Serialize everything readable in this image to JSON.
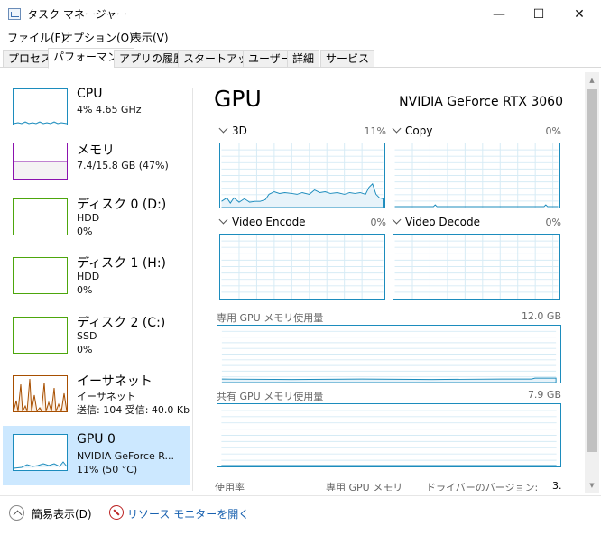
{
  "window": {
    "title": "タスク マネージャー",
    "minimize_glyph": "—",
    "maximize_glyph": "☐",
    "close_glyph": "✕"
  },
  "menu": [
    "ファイル(F)",
    "オプション(O)",
    "表示(V)"
  ],
  "tabs": [
    {
      "label": "プロセス",
      "active": false
    },
    {
      "label": "パフォーマンス",
      "active": true
    },
    {
      "label": "アプリの履歴",
      "active": false
    },
    {
      "label": "スタートアップ",
      "active": false
    },
    {
      "label": "ユーザー",
      "active": false
    },
    {
      "label": "詳細",
      "active": false
    },
    {
      "label": "サービス",
      "active": false
    }
  ],
  "sidebar": {
    "items": [
      {
        "name": "CPU",
        "line1": "4%  4.65 GHz",
        "line2": "",
        "line3": "",
        "color": "#1c8cbd"
      },
      {
        "name": "メモリ",
        "line1": "7.4/15.8 GB (47%)",
        "line2": "",
        "line3": "",
        "color": "#8b12ae",
        "fill": 0.47
      },
      {
        "name": "ディスク 0 (D:)",
        "line1": "HDD",
        "line2": "0%",
        "line3": "",
        "color": "#4da60c"
      },
      {
        "name": "ディスク 1 (H:)",
        "line1": "HDD",
        "line2": "0%",
        "line3": "",
        "color": "#4da60c"
      },
      {
        "name": "ディスク 2 (C:)",
        "line1": "SSD",
        "line2": "0%",
        "line3": "",
        "color": "#4da60c"
      },
      {
        "name": "イーサネット",
        "line1": "イーサネット",
        "line2": "送信: 104  受信: 40.0 Kbps",
        "line3": "",
        "color": "#a74f01"
      },
      {
        "name": "GPU 0",
        "line1": "NVIDIA GeForce R...",
        "line2": "11%  (50 °C)",
        "line3": "",
        "color": "#1c8cbd"
      }
    ]
  },
  "gpu": {
    "title": "GPU",
    "model": "NVIDIA GeForce RTX 3060",
    "engines": [
      {
        "label": "3D",
        "percent": "11%",
        "utilization": 0.11
      },
      {
        "label": "Copy",
        "percent": "0%",
        "utilization": 0.0
      },
      {
        "label": "Video Encode",
        "percent": "0%",
        "utilization": 0.0
      },
      {
        "label": "Video Decode",
        "percent": "0%",
        "utilization": 0.0
      }
    ],
    "dedicated_memory": {
      "label": "専用 GPU メモリ使用量",
      "max": "12.0 GB"
    },
    "shared_memory": {
      "label": "共有 GPU メモリ使用量",
      "max": "7.9 GB"
    },
    "bottom_labels": [
      "使用率",
      "専用 GPU メモリ",
      "ドライバーのバージョン:",
      "3."
    ]
  },
  "footer": {
    "fewer_details": "簡易表示(D)",
    "open_resmon": "リソース モニターを開く"
  },
  "colors": {
    "accent": "#1c8cbd",
    "selected": "#cce8ff",
    "link": "#1a62b0"
  }
}
